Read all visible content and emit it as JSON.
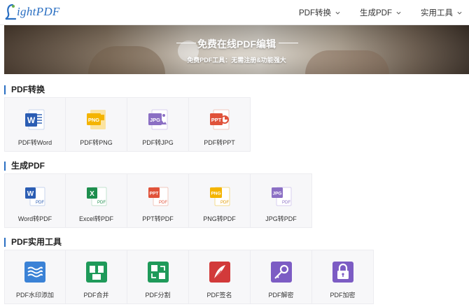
{
  "header": {
    "logo_text": "ightPDF",
    "nav": [
      {
        "label": "PDF转换"
      },
      {
        "label": "生成PDF"
      },
      {
        "label": "实用工具"
      }
    ]
  },
  "banner": {
    "title": "免费在线PDF编辑",
    "subtitle": "免费PDF工具：无需注册&功能强大"
  },
  "sections": [
    {
      "title": "PDF转换",
      "items": [
        {
          "label": "PDF转Word",
          "icon": "word-icon"
        },
        {
          "label": "PDF转PNG",
          "icon": "png-icon"
        },
        {
          "label": "PDF转JPG",
          "icon": "jpg-icon"
        },
        {
          "label": "PDF转PPT",
          "icon": "ppt-icon"
        }
      ]
    },
    {
      "title": "生成PDF",
      "items": [
        {
          "label": "Word转PDF",
          "icon": "word-to-pdf-icon"
        },
        {
          "label": "Excel转PDF",
          "icon": "excel-to-pdf-icon"
        },
        {
          "label": "PPT转PDF",
          "icon": "ppt-to-pdf-icon"
        },
        {
          "label": "PNG转PDF",
          "icon": "png-to-pdf-icon"
        },
        {
          "label": "JPG转PDF",
          "icon": "jpg-to-pdf-icon"
        }
      ]
    },
    {
      "title": "PDF实用工具",
      "items": [
        {
          "label": "PDF水印添加",
          "icon": "watermark-icon"
        },
        {
          "label": "PDF合并",
          "icon": "merge-icon"
        },
        {
          "label": "PDF分割",
          "icon": "split-icon"
        },
        {
          "label": "PDF签名",
          "icon": "sign-icon"
        },
        {
          "label": "PDF解密",
          "icon": "key-icon"
        },
        {
          "label": "PDF加密",
          "icon": "lock-icon"
        }
      ]
    }
  ],
  "icon_text": {
    "word": "W",
    "excel": "X",
    "png": "PNG",
    "jpg": "JPG",
    "ppt": "PPT",
    "pdf": "PDF"
  },
  "colors": {
    "brand": "#2a6fc2",
    "word": "#2b5db3",
    "png": "#f4b400",
    "jpg": "#8b6fc4",
    "ppt": "#e0523a",
    "excel": "#1e8e4e",
    "watermark": "#3b82d6",
    "merge": "#1f9a5a",
    "split": "#1f9a5a",
    "sign": "#d23a3a",
    "key": "#7c5cc4",
    "lock": "#7c5cc4"
  }
}
